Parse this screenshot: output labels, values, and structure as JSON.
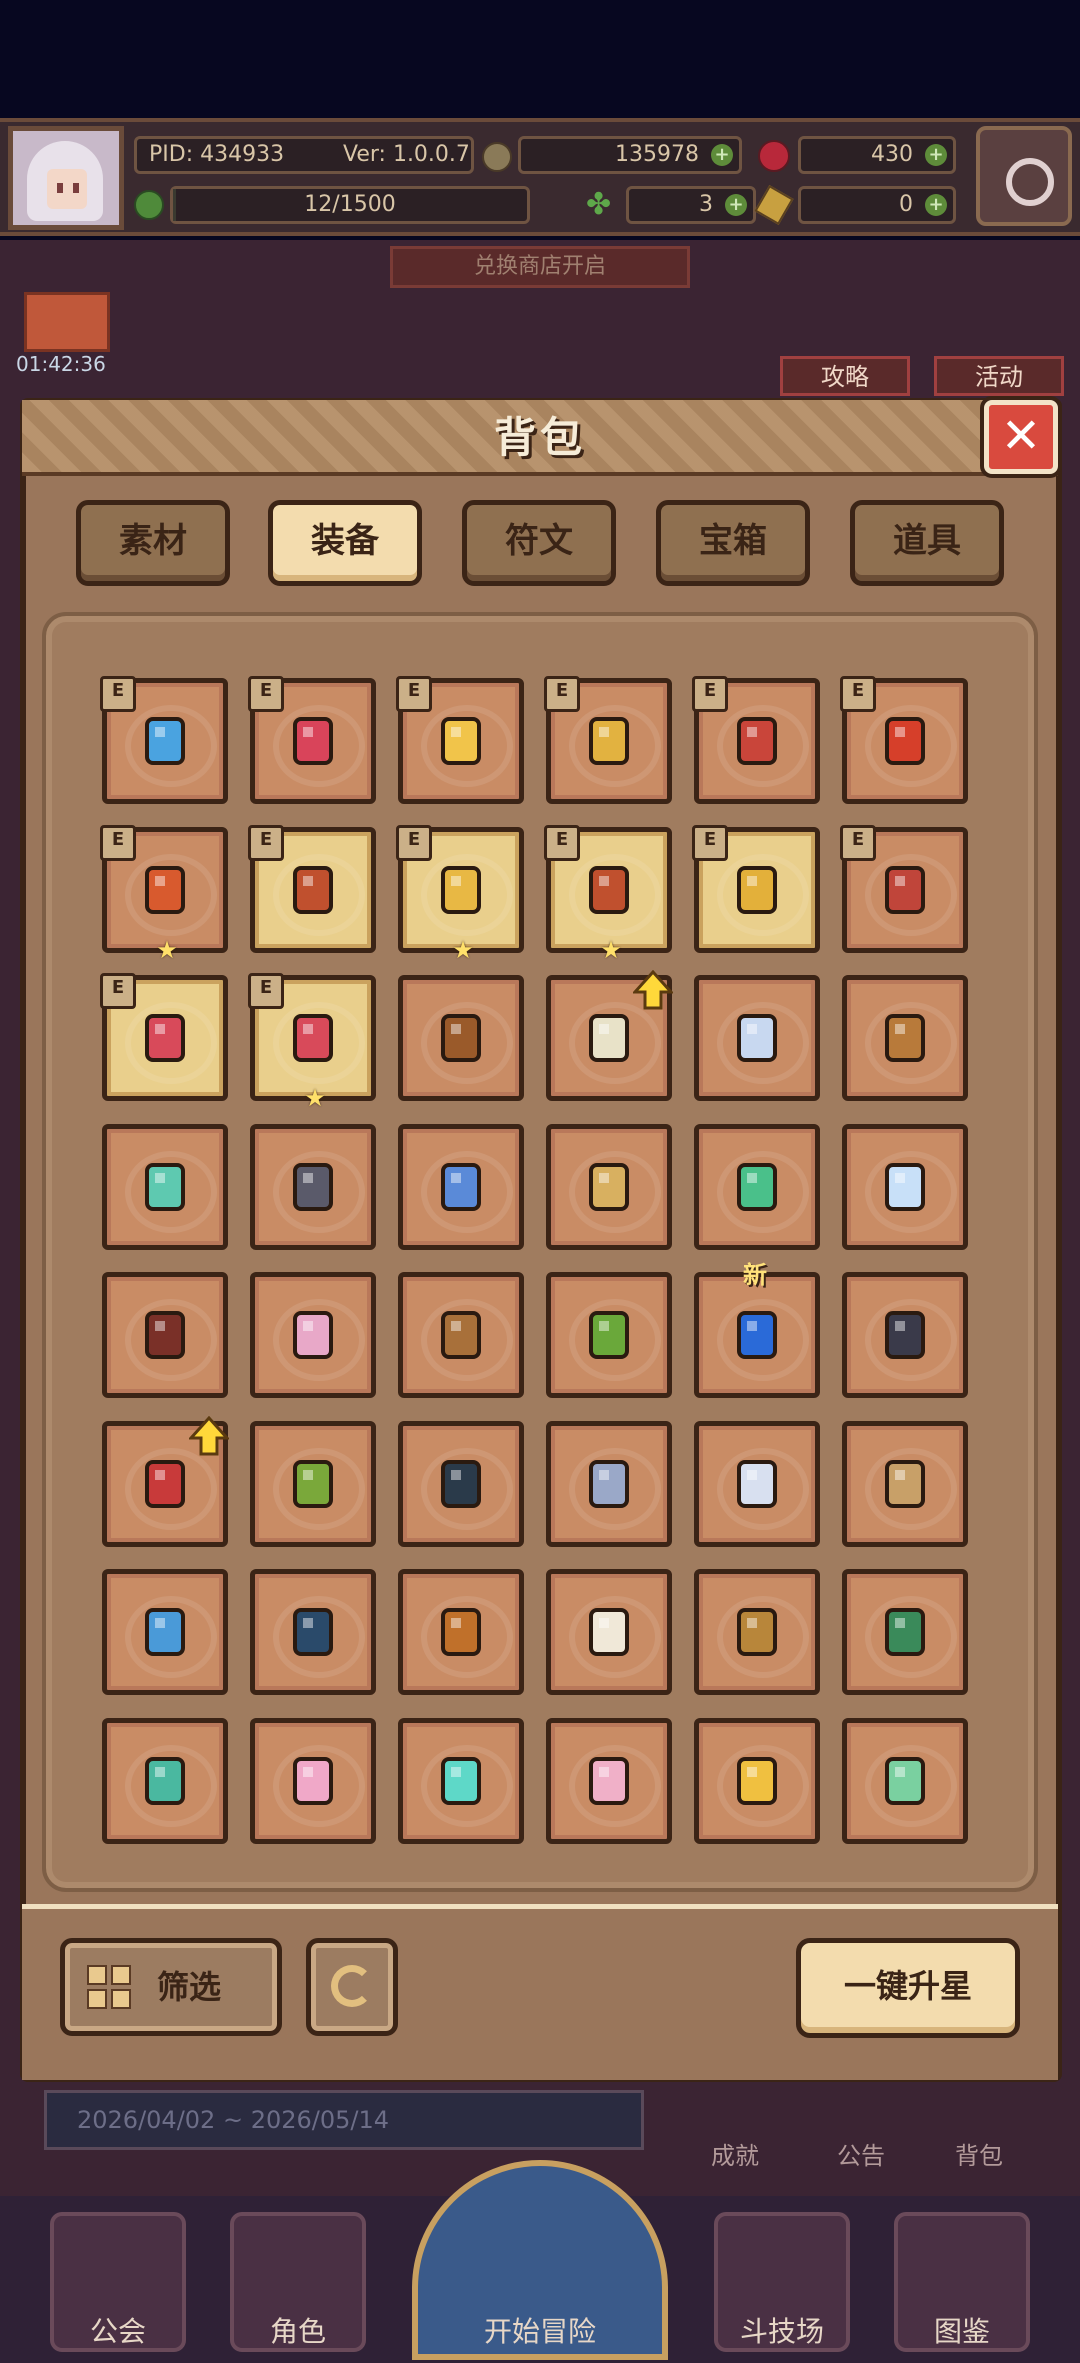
{
  "hud": {
    "pid": "PID: 434933",
    "version": "Ver: 1.0.0.7",
    "gold": "135978",
    "gems": "430",
    "energy": "12/1500",
    "clover": "3",
    "keys": "0"
  },
  "scene": {
    "shop_banner": "兑换商店开启",
    "timer": "01:42:36",
    "guide_label": "攻略",
    "event_label": "活动",
    "event_dates": "2026/04/02 ~ 2026/05/14",
    "small_buttons": [
      "成就",
      "公告",
      "背包"
    ],
    "bottom_nav": [
      "公会",
      "角色",
      "开始冒险",
      "斗技场",
      "图鉴"
    ]
  },
  "bag": {
    "title": "背包",
    "tabs": [
      {
        "label": "素材",
        "active": false
      },
      {
        "label": "装备",
        "active": true
      },
      {
        "label": "符文",
        "active": false
      },
      {
        "label": "宝箱",
        "active": false
      },
      {
        "label": "道具",
        "active": false
      }
    ],
    "slots": [
      {
        "icon": "scepter-icon",
        "color": "#4aa3e0",
        "e": true,
        "star": false,
        "gold": false
      },
      {
        "icon": "teddy-bear-icon",
        "color": "#d9445a",
        "e": true,
        "star": false,
        "gold": false
      },
      {
        "icon": "gold-ring-icon",
        "color": "#f1c44a",
        "e": true,
        "star": false,
        "gold": false
      },
      {
        "icon": "gold-ring-icon",
        "color": "#e2b240",
        "e": true,
        "star": false,
        "gold": false
      },
      {
        "icon": "armor-icon",
        "color": "#c9453a",
        "e": true,
        "star": false,
        "gold": false
      },
      {
        "icon": "armor-icon",
        "color": "#d63f2a",
        "e": true,
        "star": false,
        "gold": false
      },
      {
        "icon": "gauntlet-icon",
        "color": "#d85a2e",
        "e": true,
        "star": true,
        "gold": false
      },
      {
        "icon": "bracer-icon",
        "color": "#c0502e",
        "e": true,
        "star": false,
        "gold": true
      },
      {
        "icon": "necklace-icon",
        "color": "#e8b844",
        "e": true,
        "star": true,
        "gold": true
      },
      {
        "icon": "ruby-helm-icon",
        "color": "#c0502e",
        "e": true,
        "star": true,
        "gold": true
      },
      {
        "icon": "boots-icon",
        "color": "#e3b03a",
        "e": true,
        "star": false,
        "gold": true
      },
      {
        "icon": "boots-icon",
        "color": "#c0453a",
        "e": true,
        "star": false,
        "gold": false
      },
      {
        "icon": "ruby-plate-icon",
        "color": "#d84a5a",
        "e": true,
        "star": false,
        "gold": true
      },
      {
        "icon": "ruby-necklace-icon",
        "color": "#d84a5a",
        "e": true,
        "star": true,
        "gold": true
      },
      {
        "icon": "crossbow-icon",
        "color": "#9a5a2a",
        "e": false,
        "star": false,
        "gold": false
      },
      {
        "icon": "bow-icon",
        "color": "#e8e2c8",
        "e": false,
        "star": false,
        "gold": false,
        "up": true
      },
      {
        "icon": "sword-icon",
        "color": "#c8d8f0",
        "e": false,
        "star": false,
        "gold": false
      },
      {
        "icon": "pickaxe-icon",
        "color": "#b87a3a",
        "e": false,
        "star": false,
        "gold": false
      },
      {
        "icon": "mace-icon",
        "color": "#5ec9b0",
        "e": false,
        "star": false,
        "gold": false
      },
      {
        "icon": "dark-sword-icon",
        "color": "#5a5a6a",
        "e": false,
        "star": false,
        "gold": false
      },
      {
        "icon": "blue-sword-icon",
        "color": "#5a8ad8",
        "e": false,
        "star": false,
        "gold": false
      },
      {
        "icon": "golden-bow-icon",
        "color": "#d8b060",
        "e": false,
        "star": false,
        "gold": false
      },
      {
        "icon": "jade-arrow-icon",
        "color": "#4ac08a",
        "e": false,
        "star": false,
        "gold": false
      },
      {
        "icon": "crystal-icon",
        "color": "#c8e0f8",
        "e": false,
        "star": false,
        "gold": false
      },
      {
        "icon": "hood-icon",
        "color": "#7a3028",
        "e": false,
        "star": false,
        "gold": false
      },
      {
        "icon": "pink-robe-icon",
        "color": "#e8a8c8",
        "e": false,
        "star": false,
        "gold": false
      },
      {
        "icon": "leather-vest-icon",
        "color": "#a8703a",
        "e": false,
        "star": false,
        "gold": false
      },
      {
        "icon": "green-armor-icon",
        "color": "#6aa83a",
        "e": false,
        "star": false,
        "gold": false
      },
      {
        "icon": "blue-armor-icon",
        "color": "#2a6ad8",
        "e": false,
        "star": false,
        "gold": false,
        "new": true
      },
      {
        "icon": "dark-glove-icon",
        "color": "#3a3a4a",
        "e": false,
        "star": false,
        "gold": false
      },
      {
        "icon": "red-boots-icon",
        "color": "#c83a3a",
        "e": false,
        "star": false,
        "gold": false,
        "up": true
      },
      {
        "icon": "green-bracer-icon",
        "color": "#7aa83a",
        "e": false,
        "star": false,
        "gold": false
      },
      {
        "icon": "dark-helm-icon",
        "color": "#2a3a4a",
        "e": false,
        "star": false,
        "gold": false
      },
      {
        "icon": "wolf-helm-icon",
        "color": "#9aa8c8",
        "e": false,
        "star": false,
        "gold": false
      },
      {
        "icon": "white-armor-icon",
        "color": "#d8e0f0",
        "e": false,
        "star": false,
        "gold": false
      },
      {
        "icon": "bone-bracer-icon",
        "color": "#c8a068",
        "e": false,
        "star": false,
        "gold": false
      },
      {
        "icon": "eye-charm-icon",
        "color": "#4a9ad8",
        "e": false,
        "star": false,
        "gold": false
      },
      {
        "icon": "rose-ring-icon",
        "color": "#2a4a6a",
        "e": false,
        "star": false,
        "gold": false
      },
      {
        "icon": "copper-ring-icon",
        "color": "#c0702a",
        "e": false,
        "star": false,
        "gold": false
      },
      {
        "icon": "pearl-ring-icon",
        "color": "#f0e8d8",
        "e": false,
        "star": false,
        "gold": false
      },
      {
        "icon": "bronze-ring-icon",
        "color": "#b8863a",
        "e": false,
        "star": false,
        "gold": false
      },
      {
        "icon": "green-boots-icon",
        "color": "#3a8a5a",
        "e": false,
        "star": false,
        "gold": false
      },
      {
        "icon": "jade-boots-icon",
        "color": "#4ab8a0",
        "e": false,
        "star": false,
        "gold": false
      },
      {
        "icon": "heart-charm-icon",
        "color": "#f0a8c8",
        "e": false,
        "star": false,
        "gold": false
      },
      {
        "icon": "diamond-icon",
        "color": "#5ed8c8",
        "e": false,
        "star": false,
        "gold": false
      },
      {
        "icon": "heart-necklace-icon",
        "color": "#f0b0c8",
        "e": false,
        "star": false,
        "gold": false
      },
      {
        "icon": "gold-collar-icon",
        "color": "#f0c040",
        "e": false,
        "star": false,
        "gold": false
      },
      {
        "icon": "jade-necklace-icon",
        "color": "#7ad0a0",
        "e": false,
        "star": false,
        "gold": false
      }
    ],
    "filter_label": "筛选",
    "upgrade_all_label": "一键升星"
  }
}
